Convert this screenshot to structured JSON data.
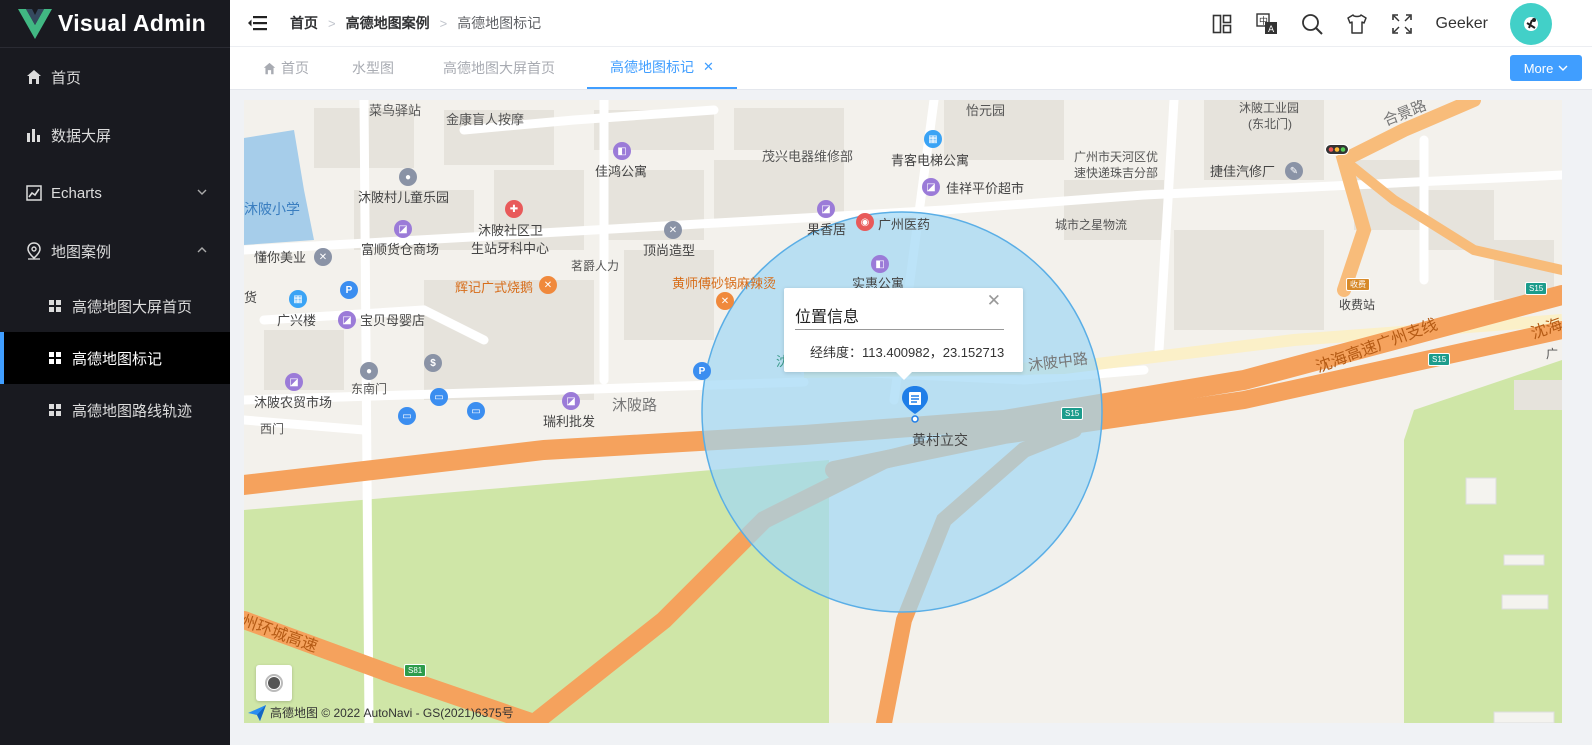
{
  "app": {
    "title": "Visual Admin"
  },
  "sidebar": {
    "items": [
      {
        "label": "首页",
        "icon": "home-icon"
      },
      {
        "label": "数据大屏",
        "icon": "bar-chart-icon"
      },
      {
        "label": "Echarts",
        "icon": "line-chart-icon",
        "expanded": false
      },
      {
        "label": "地图案例",
        "icon": "map-pin-icon",
        "expanded": true,
        "children": [
          {
            "label": "高德地图大屏首页",
            "icon": "grid-icon"
          },
          {
            "label": "高德地图标记",
            "icon": "grid-icon",
            "active": true
          },
          {
            "label": "高德地图路线轨迹",
            "icon": "grid-icon"
          }
        ]
      }
    ]
  },
  "header": {
    "breadcrumb": [
      "首页",
      "高德地图案例",
      "高德地图标记"
    ],
    "username": "Geeker",
    "icons": [
      "layout-icon",
      "translate-icon",
      "search-icon",
      "theme-shirt-icon",
      "fullscreen-icon"
    ]
  },
  "tabs": {
    "items": [
      {
        "label": "首页",
        "home": true
      },
      {
        "label": "水型图"
      },
      {
        "label": "高德地图大屏首页"
      },
      {
        "label": "高德地图标记",
        "active": true
      }
    ],
    "more_label": "More"
  },
  "map": {
    "info_window": {
      "title": "位置信息",
      "body": "经纬度：113.400982，23.152713"
    },
    "marker_label": "黄村立交",
    "labels": {
      "l1": "菜鸟驿站",
      "l2": "金康盲人按摩",
      "l3": "怡元园",
      "l4": "沐陂工业园",
      "l5": "(东北门)",
      "l6": "合景路",
      "l7": "茂兴电器维修部",
      "l8": "青客电梯公寓",
      "l9": "广州市天河区优",
      "l10": "速快递珠吉分部",
      "l11": "捷佳汽修厂",
      "l12": "佳鸿公寓",
      "l13": "沐陂村儿童乐园",
      "l14": "佳祥平价超市",
      "l15": "沐陂小学",
      "l16": "沐陂社区卫",
      "l17": "生站牙科中心",
      "l18": "果香居",
      "l19": "广州医药",
      "l20": "城市之星物流",
      "l21": "富顺货仓商场",
      "l22": "顶尚造型",
      "l23": "懂你美业",
      "l24": "茗爵人力",
      "l25": "实惠公寓",
      "l26": "辉记广式烧鹅",
      "l27": "黄师傅砂锅麻辣烫",
      "l28": "收费站",
      "l29": "广兴楼",
      "l30": "宝贝母婴店",
      "l31": "沐陂中路",
      "l32": "沈海高速广州支线",
      "l33": "沈海",
      "l34": "东南门",
      "l35": "沐陂农贸市场",
      "l36": "瑞利批发",
      "l37": "沐陂路",
      "l38": "西门",
      "l39": "州环城高速",
      "l40": "货",
      "l41": "沈",
      "l42": "广",
      "l43": "收费"
    },
    "shields": {
      "s15": "S15",
      "s81": "S81"
    },
    "copyright": "高德地图 © 2022 AutoNavi - GS(2021)6375号"
  },
  "colors": {
    "accent": "#409eff",
    "sidebar_bg": "#191a20",
    "avatar_bg": "#42d0c8",
    "highway": "#f5a25d"
  }
}
